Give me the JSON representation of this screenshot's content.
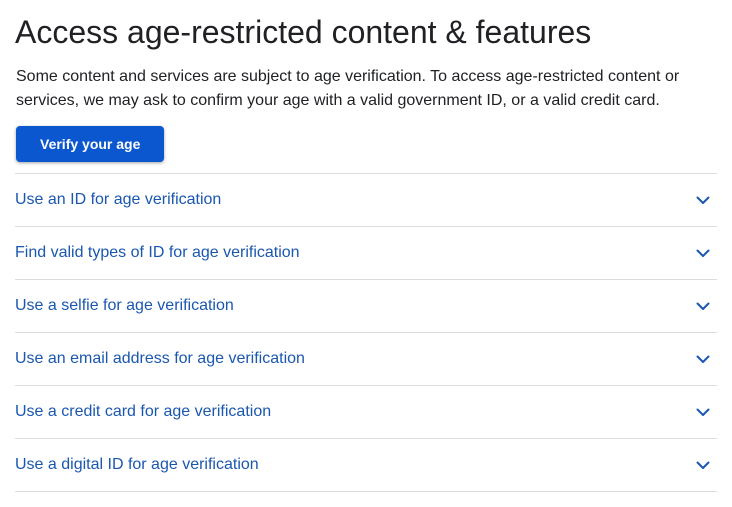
{
  "page": {
    "title": "Access age-restricted content & features",
    "intro": "Some content and services are subject to age verification. To access age-restricted content or services, we may ask to confirm your age with a valid government ID, or a valid credit card.",
    "verify_button": "Verify your age"
  },
  "accordion": {
    "items": [
      {
        "label": "Use an ID for age verification",
        "icon": "chevron-down-icon"
      },
      {
        "label": "Find valid types of ID for age verification",
        "icon": "chevron-down-icon"
      },
      {
        "label": "Use a selfie for age verification",
        "icon": "chevron-down-icon"
      },
      {
        "label": "Use an email address for age verification",
        "icon": "chevron-down-icon"
      },
      {
        "label": "Use a credit card for age verification",
        "icon": "chevron-down-icon"
      },
      {
        "label": "Use a digital ID for age verification",
        "icon": "chevron-down-icon"
      }
    ]
  },
  "colors": {
    "primary_button": "#0b57d0",
    "link": "#1a57b0",
    "divider": "#dadce0",
    "text": "#202124"
  }
}
